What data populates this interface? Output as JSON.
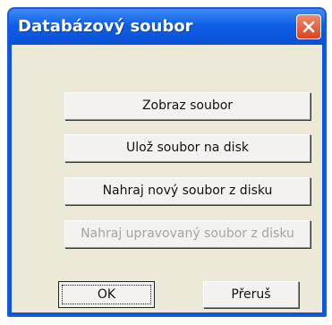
{
  "window": {
    "title": "Databázový soubor",
    "close_icon": "close-x-icon"
  },
  "buttons": {
    "show_file": "Zobraz soubor",
    "save_to_disk": "Ulož soubor na disk",
    "load_new": "Nahraj nový soubor z disku",
    "load_modified": "Nahraj upravovaný soubor z disku",
    "ok": "OK",
    "cancel": "Přeruš"
  },
  "states": {
    "load_modified_enabled": false,
    "default_button": "ok"
  },
  "colors": {
    "titlebar": "#0f5fe6",
    "close_button": "#d9441f",
    "dialog_background": "#ece9d8",
    "disabled_text": "#a6a59d"
  }
}
